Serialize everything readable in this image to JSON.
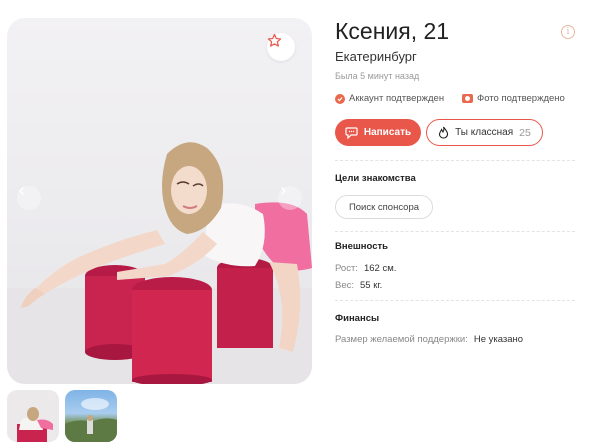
{
  "profile": {
    "name_age": "Ксения, 21",
    "city": "Екатеринбург",
    "last_seen": "Была 5 минут назад",
    "info_glyph": "i"
  },
  "verification": [
    {
      "label": "Аккаунт подтвержден",
      "icon": "check-circle-icon"
    },
    {
      "label": "Фото подтверждено",
      "icon": "camera-icon"
    }
  ],
  "actions": {
    "write_label": "Написать",
    "cool_label": "Ты классная",
    "cool_count": "25"
  },
  "goals": {
    "title": "Цели знакомства",
    "items": [
      "Поиск спонсора"
    ]
  },
  "appearance": {
    "title": "Внешность",
    "height_label": "Рост:",
    "height_value": "162 см.",
    "weight_label": "Вес:",
    "weight_value": "55 кг."
  },
  "finances": {
    "title": "Финансы",
    "support_label": "Размер желаемой поддержки:",
    "support_value": "Не указано"
  },
  "colors": {
    "accent": "#e9574b",
    "pouf": "#c81f4f"
  }
}
